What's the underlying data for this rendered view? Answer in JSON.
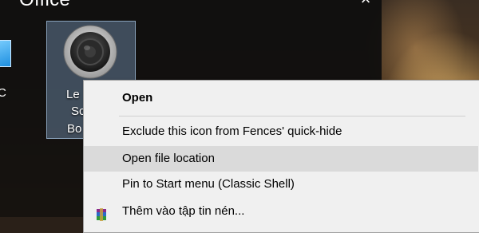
{
  "fence": {
    "title": "Office"
  },
  "desktop": {
    "pc_label": "C",
    "selected_icon": {
      "label_line1": "Le",
      "label_line2": "Sc",
      "label_line3": "Bo"
    }
  },
  "context_menu": {
    "items": [
      {
        "label": "Open",
        "bold": true
      },
      {
        "label": "Exclude this icon from Fences' quick-hide"
      },
      {
        "label": "Open file location",
        "state": "hovered"
      },
      {
        "label": "Pin to Start menu (Classic Shell)"
      },
      {
        "label": "Thêm vào tập tin nén...",
        "icon": "winrar-icon"
      }
    ]
  },
  "colors": {
    "menu_bg": "#f0f0f0",
    "menu_hover": "#dadada",
    "fence_bg": "#0e0e0e",
    "selection": "#7896b9"
  }
}
